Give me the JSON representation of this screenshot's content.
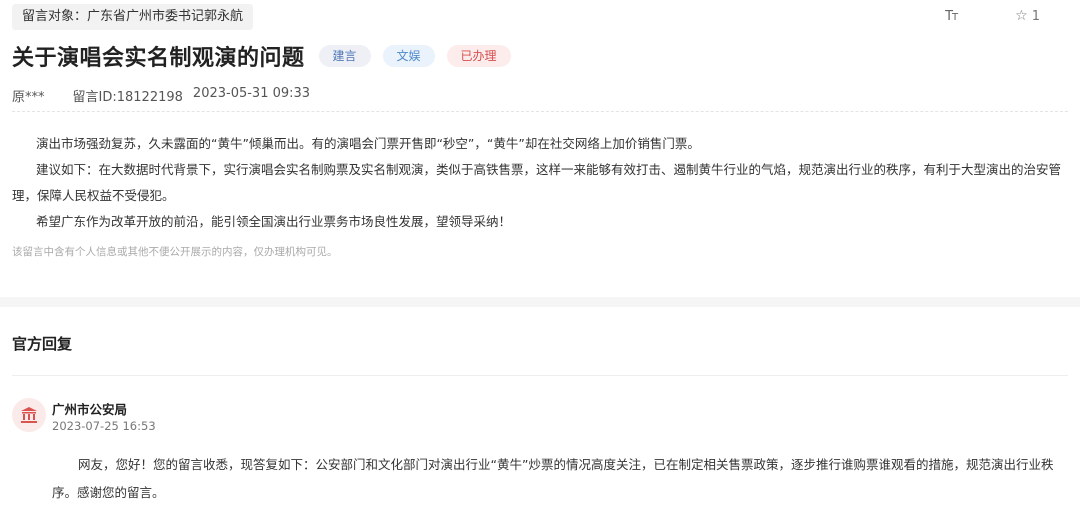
{
  "header": {
    "recipient": "留言对象：广东省广州市委书记郭永航",
    "font_size_icon": "font-size-icon",
    "favorite_icon": "star-icon",
    "favorite_count": "1"
  },
  "post": {
    "title": "关于演唱会实名制观演的问题",
    "tags": [
      "建言",
      "文娱",
      "已办理"
    ],
    "author": "原***",
    "message_id": "留言ID:18122198",
    "datetime": "2023-05-31 09:33",
    "paragraphs": [
      "演出市场强劲复苏，久未露面的“黄牛”倾巢而出。有的演唱会门票开售即“秒空”，“黄牛”却在社交网络上加价销售门票。",
      "建议如下：在大数据时代背景下，实行演唱会实名制购票及实名制观演，类似于高铁售票，这样一来能够有效打击、遏制黄牛行业的气焰，规范演出行业的秩序，有利于大型演出的治安管理，保障人民权益不受侵犯。",
      "希望广东作为改革开放的前沿，能引领全国演出行业票务市场良性发展，望领导采纳！"
    ],
    "privacy_notice": "该留言中含有个人信息或其他不便公开展示的内容，仅办理机构可见。"
  },
  "reply": {
    "heading": "官方回复",
    "department": "广州市公安局",
    "department_icon": "government-building-icon",
    "datetime": "2023-07-25 16:53",
    "content": "网友，您好！您的留言收悉，现答复如下：公安部门和文化部门对演出行业“黄牛”炒票的情况高度关注，已在制定相关售票政策，逐步推行谁购票谁观看的措施，规范演出行业秩序。感谢您的留言。"
  },
  "colors": {
    "tag_suggest": "#4f78b6",
    "tag_culture": "#4f8acb",
    "tag_done": "#d4504f",
    "dept_icon": "#d9534f"
  }
}
